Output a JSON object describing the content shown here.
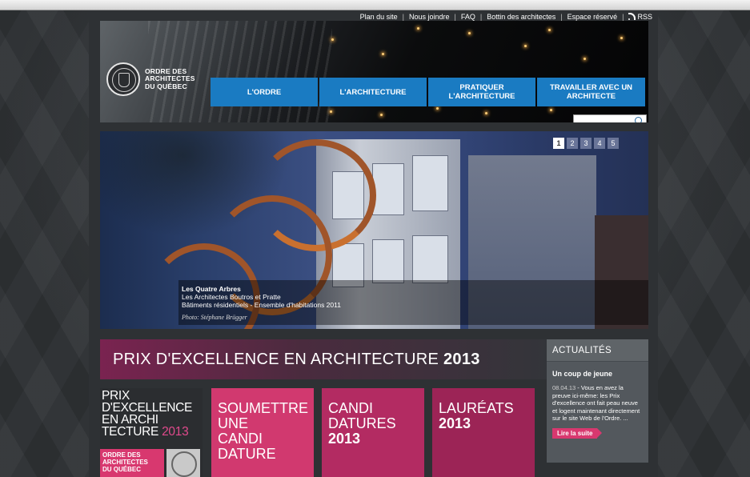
{
  "util_links": [
    "Plan du site",
    "Nous joindre",
    "FAQ",
    "Bottin des architectes",
    "Espace réservé",
    "RSS"
  ],
  "logo": {
    "lines": [
      "ORDRE DES",
      "ARCHITECTES",
      "DU QUÉBEC"
    ]
  },
  "nav": [
    {
      "label": "L'ORDRE"
    },
    {
      "label": "L'ARCHITECTURE"
    },
    {
      "label": "PRATIQUER L'ARCHITECTURE"
    },
    {
      "label": "TRAVAILLER AVEC UN ARCHITECTE"
    }
  ],
  "search": {
    "placeholder": "",
    "value": ""
  },
  "slider": {
    "pages": [
      "1",
      "2",
      "3",
      "4",
      "5"
    ],
    "active_page": "1",
    "caption_title": "Les Quatre Arbres",
    "caption_line2": "Les Architectes Boutros et Pratte",
    "caption_line3": "Bâtiments résidentiels - Ensemble d'habitations 2011",
    "photo_credit": "Photo: Stéphane Brügger"
  },
  "prix": {
    "banner_text": "PRIX D'EXCELLENCE EN ARCHITECTURE",
    "banner_year": "2013",
    "logo_lines": [
      "PRIX",
      "D'EXCELLENCE",
      "EN ARCHI",
      "TECTURE"
    ],
    "logo_year": "2013",
    "ordre_lines": [
      "ORDRE DES",
      "ARCHITECTES",
      "DU QUÉBEC"
    ]
  },
  "tiles": [
    {
      "lines": [
        "SOUMETTRE",
        "UNE",
        "CANDI",
        "DATURE"
      ],
      "year": ""
    },
    {
      "lines": [
        "CANDI",
        "DATURES"
      ],
      "year": "2013"
    },
    {
      "lines": [
        "LAURÉATS"
      ],
      "year": "2013"
    }
  ],
  "news": {
    "heading": "ACTUALITÉS",
    "title": "Un coup de jeune",
    "date": "08.04.13",
    "text": " - Vous en avez la preuve ici-même: les Prix d'excellence ont fait peau neuve et logent maintenant directement sur le site Web de l'Ordre. ...",
    "read_more": "Lire la suite"
  }
}
